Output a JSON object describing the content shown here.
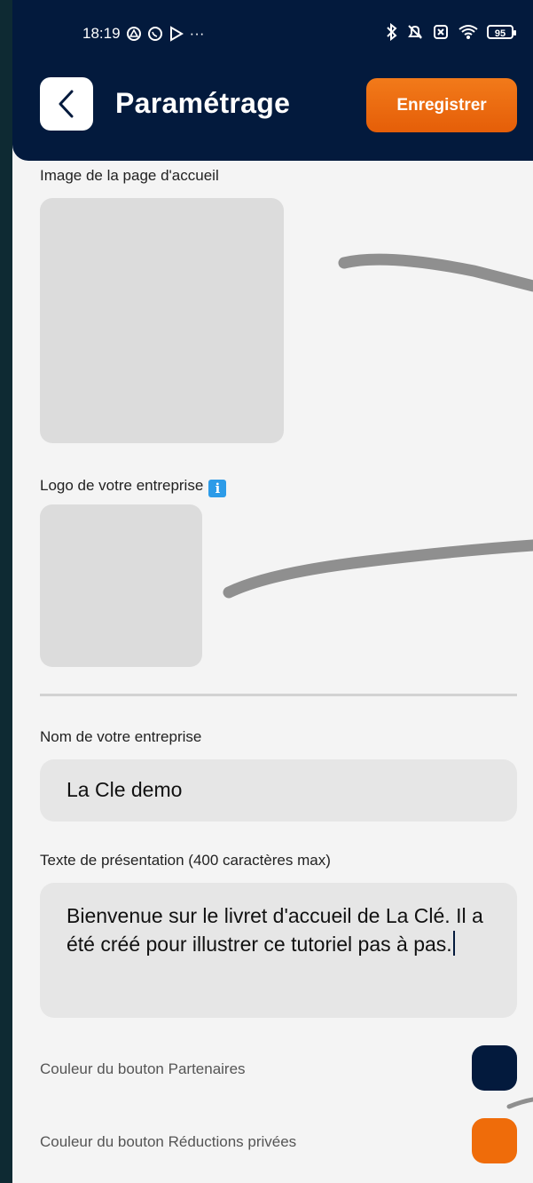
{
  "status_bar": {
    "time": "18:19",
    "more": "···",
    "battery": "95"
  },
  "header": {
    "title": "Paramétrage",
    "save_label": "Enregistrer"
  },
  "sections": {
    "home_image_label": "Image de la page d'accueil",
    "logo_label": "Logo de votre entreprise",
    "company_name_label": "Nom de votre entreprise",
    "company_name_value": "La Cle demo",
    "presentation_label": "Texte de présentation (400 caractères max)",
    "presentation_value": "Bienvenue sur le livret d'accueil de La Clé. Il a été créé pour illustrer ce tutoriel pas à pas.",
    "partners_color_label": "Couleur du bouton Partenaires",
    "private_color_label": "Couleur du bouton Réductions privées"
  },
  "colors": {
    "header_bg": "#031a3d",
    "accent": "#ef6c0a",
    "partners_button": "#031a3d",
    "private_button": "#ef6c0a"
  }
}
